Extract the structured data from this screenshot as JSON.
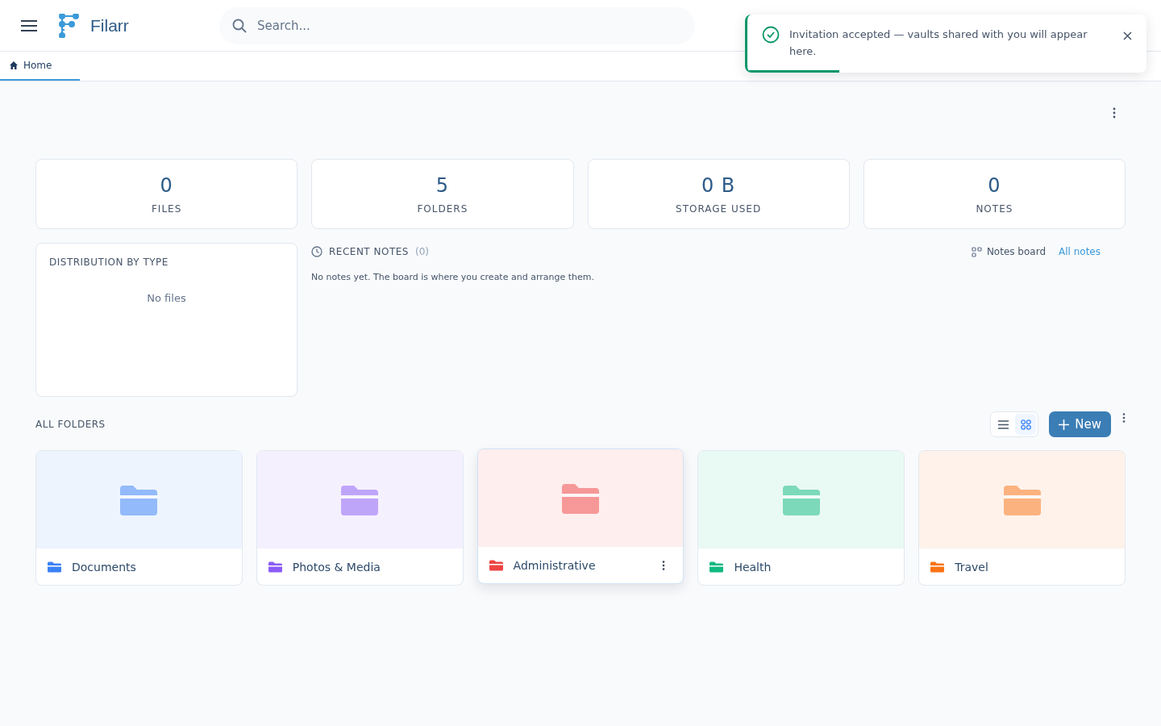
{
  "app": {
    "name": "Filarr"
  },
  "search": {
    "placeholder": "Search..."
  },
  "tabs": [
    {
      "label": "Home",
      "selected": true
    }
  ],
  "toast": {
    "message": "Invitation accepted — vaults shared with you will appear here.",
    "level": 0.23
  },
  "stats": [
    {
      "value": "0",
      "label": "FILES"
    },
    {
      "value": "5",
      "label": "FOLDERS"
    },
    {
      "value": "0 B",
      "label": "STORAGE USED"
    },
    {
      "value": "0",
      "label": "NOTES"
    }
  ],
  "distribution": {
    "title": "DISTRIBUTION BY TYPE",
    "empty": "No files"
  },
  "recent_notes": {
    "title": "RECENT NOTES",
    "count": "(0)",
    "board_link": "Notes board",
    "all_link": "All notes",
    "empty": "No notes yet. The board is where you create and arrange them."
  },
  "folders_section": {
    "title": "ALL FOLDERS",
    "views": [
      {
        "kind": "list",
        "selected": false
      },
      {
        "kind": "grid",
        "selected": true
      }
    ],
    "new_button": "New"
  },
  "folders": [
    {
      "name": "Documents",
      "color": "#3b82f6",
      "hovered": false
    },
    {
      "name": "Photos & Media",
      "color": "#8b5cf6",
      "hovered": false
    },
    {
      "name": "Administrative",
      "color": "#ef4444",
      "hovered": true
    },
    {
      "name": "Health",
      "color": "#10b981",
      "hovered": false
    },
    {
      "name": "Travel",
      "color": "#f97316",
      "hovered": false
    }
  ]
}
